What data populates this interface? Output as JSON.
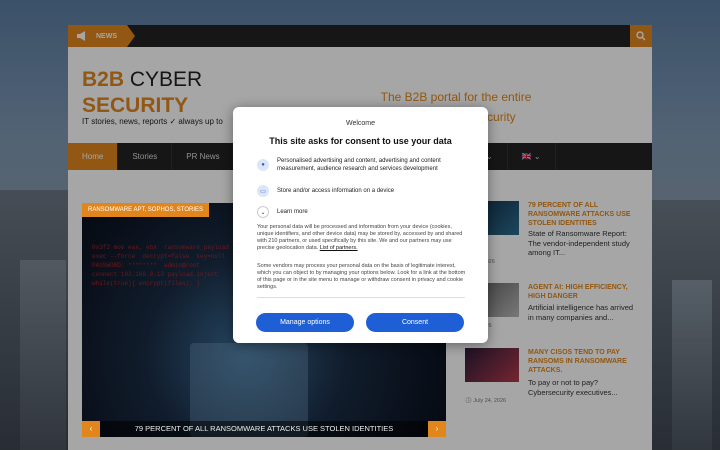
{
  "topbar": {
    "news_label": "NEWS"
  },
  "header": {
    "logo_line1_orange": "B2B",
    "logo_line1_dark": "CYBER",
    "logo_line2": "SECURITY",
    "tagline": "IT stories, news, reports ✓ always up to",
    "slogan": "The B2B portal for the entire world of cyber security"
  },
  "nav": {
    "items": [
      {
        "label": "Home"
      },
      {
        "label": "Stories"
      },
      {
        "label": "PR News"
      },
      {
        "label": "nfo"
      },
      {
        "label": "🇬🇧"
      }
    ]
  },
  "feature": {
    "category": "RANSOMWARE APT, SOPHOS, STORIES",
    "title": "79 PERCENT OF ALL RANSOMWARE ATTACKS USE STOLEN IDENTITIES",
    "code": "0x3f2 mov eax, ebx  ransomware_payload\nexec --force  decrypt=false  key=null\nPASSWORD: ********  admin@root\nconnect 192.168.0.13 payload.inject\nwhile(true){ encrypt(files); }"
  },
  "sidebar": [
    {
      "headline": "79 PERCENT OF ALL RANSOMWARE ATTACKS USE STOLEN IDENTITIES",
      "excerpt": "State of Ransomware Report: The vendor-independent study among IT...",
      "date": "29, 2026"
    },
    {
      "headline": "AGENT AI: HIGH EFFICIENCY, HIGH DANGER",
      "excerpt": "Artificial intelligence has arrived in many companies and...",
      "date": "7, 2026"
    },
    {
      "headline": "MANY CISOS TEND TO PAY RANSOMS IN RANSOMWARE ATTACKS.",
      "excerpt": "To pay or not to pay? Cybersecurity executives...",
      "date": "July 24, 2026"
    }
  ],
  "consent": {
    "welcome": "Welcome",
    "title": "This site asks for consent to use your data",
    "purpose1": "Personalised advertising and content, advertising and content measurement, audience research and services development",
    "purpose2": "Store and/or access information on a device",
    "learn_more": "Learn more",
    "para1": "Your personal data will be processed and information from your device (cookies, unique identifiers, and other device data) may be stored by, accessed by and shared with 210 partners, or used specifically by this site. We and our partners may use precise geolocation data.",
    "partners_link": "List of partners.",
    "para2": "Some vendors may process your personal data on the basis of legitimate interest, which you can object to by managing your options below. Look for a link at the bottom of this page or in the site menu to manage or withdraw consent in privacy and cookie settings.",
    "manage_label": "Manage options",
    "consent_label": "Consent"
  },
  "colors": {
    "accent": "#e0861c",
    "primary_button": "#1f5fd6",
    "nav_bg": "#222222"
  }
}
